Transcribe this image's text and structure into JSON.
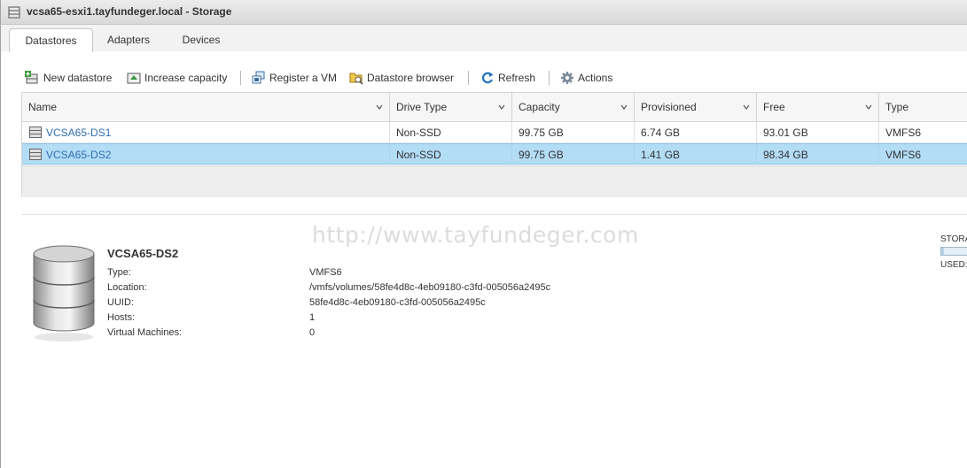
{
  "window": {
    "title": "vcsa65-esxi1.tayfundeger.local - Storage"
  },
  "tabs": [
    {
      "label": "Datastores",
      "active": true
    },
    {
      "label": "Adapters",
      "active": false
    },
    {
      "label": "Devices",
      "active": false
    }
  ],
  "toolbar": {
    "new_datastore": "New datastore",
    "increase_capacity": "Increase capacity",
    "register_vm": "Register a VM",
    "datastore_browser": "Datastore browser",
    "refresh": "Refresh",
    "actions": "Actions"
  },
  "grid": {
    "columns": [
      "Name",
      "Drive Type",
      "Capacity",
      "Provisioned",
      "Free",
      "Type"
    ],
    "rows": [
      {
        "name": "VCSA65-DS1",
        "drive_type": "Non-SSD",
        "capacity": "99.75 GB",
        "provisioned": "6.74 GB",
        "free": "93.01 GB",
        "type": "VMFS6",
        "selected": false
      },
      {
        "name": "VCSA65-DS2",
        "drive_type": "Non-SSD",
        "capacity": "99.75 GB",
        "provisioned": "1.41 GB",
        "free": "98.34 GB",
        "type": "VMFS6",
        "selected": true
      }
    ]
  },
  "watermark": "http://www.tayfundeger.com",
  "detail": {
    "title": "VCSA65-DS2",
    "properties": [
      {
        "label": "Type:",
        "value": "VMFS6"
      },
      {
        "label": "Location:",
        "value": "/vmfs/volumes/58fe4d8c-4eb09180-c3fd-005056a2495c"
      },
      {
        "label": "UUID:",
        "value": "58fe4d8c-4eb09180-c3fd-005056a2495c"
      },
      {
        "label": "Hosts:",
        "value": "1"
      },
      {
        "label": "Virtual Machines:",
        "value": "0"
      }
    ],
    "storage_label": "STORA",
    "used_label": "USED:",
    "used_fraction": 0.0141
  },
  "colors": {
    "selected_row": "#b3dcf5",
    "link": "#2e6fb2",
    "refresh_icon": "#1e73be"
  }
}
